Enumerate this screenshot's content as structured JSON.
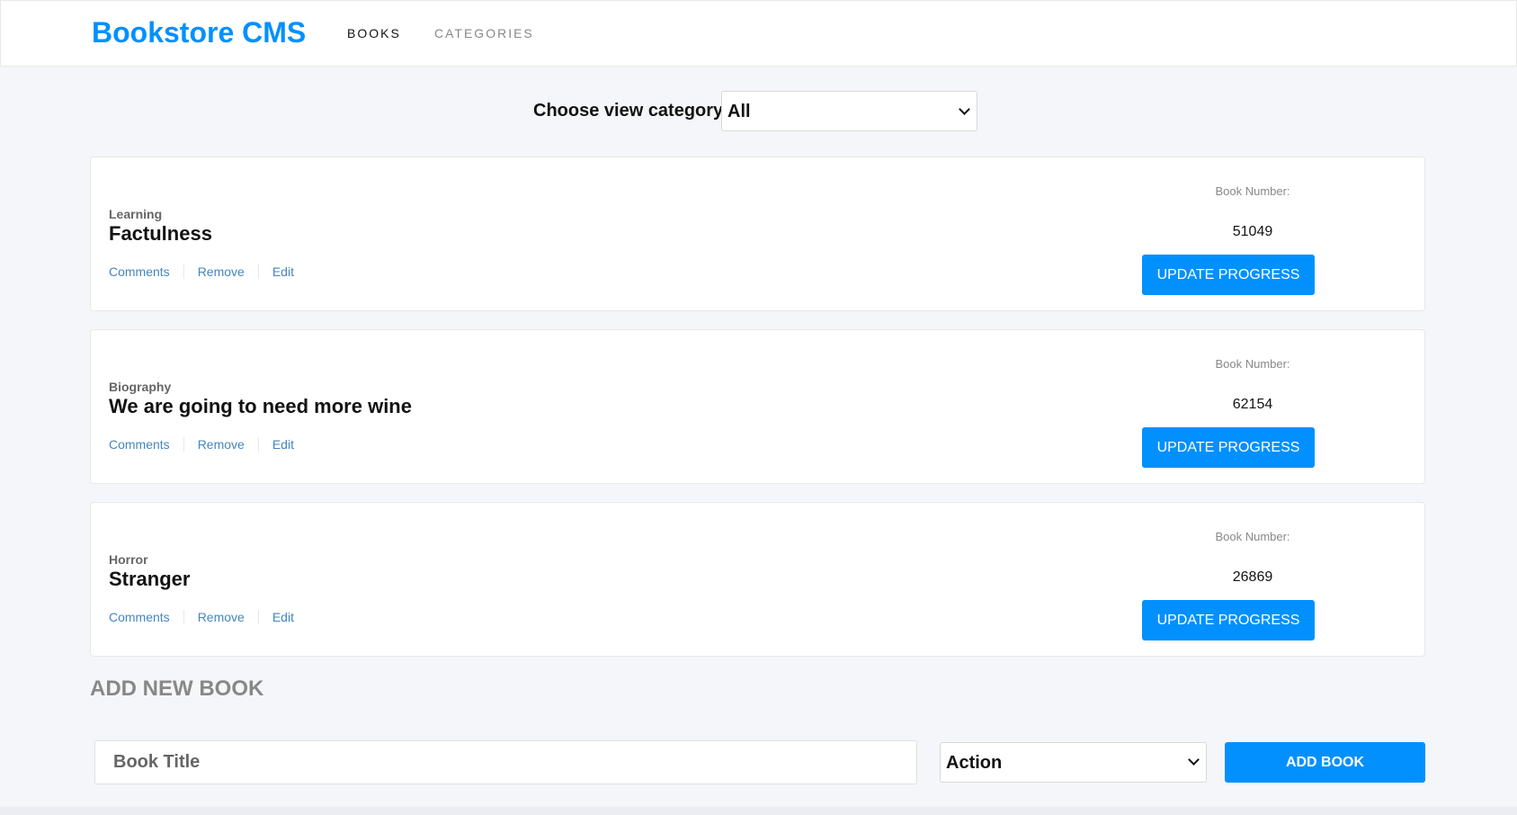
{
  "header": {
    "brand": "Bookstore CMS",
    "nav": [
      {
        "label": "BOOKS"
      },
      {
        "label": "CATEGORIES"
      }
    ]
  },
  "filter": {
    "label": "Choose view category:",
    "selected": "All"
  },
  "books": [
    {
      "category": "Learning",
      "title": "Factulness",
      "actions": [
        "Comments",
        "Remove",
        "Edit"
      ],
      "number_label": "Book Number:",
      "number": "51049",
      "button": "UPDATE PROGRESS"
    },
    {
      "category": "Biography",
      "title": "We are going to need more wine",
      "actions": [
        "Comments",
        "Remove",
        "Edit"
      ],
      "number_label": "Book Number:",
      "number": "62154",
      "button": "UPDATE PROGRESS"
    },
    {
      "category": "Horror",
      "title": "Stranger",
      "actions": [
        "Comments",
        "Remove",
        "Edit"
      ],
      "number_label": "Book Number:",
      "number": "26869",
      "button": "UPDATE PROGRESS"
    }
  ],
  "add_form": {
    "heading": "ADD NEW BOOK",
    "title_placeholder": "Book Title",
    "category_selected": "Action",
    "submit_label": "ADD BOOK"
  },
  "colors": {
    "accent": "#0290ff",
    "link": "#4386bf",
    "background": "#f5f6fa"
  }
}
